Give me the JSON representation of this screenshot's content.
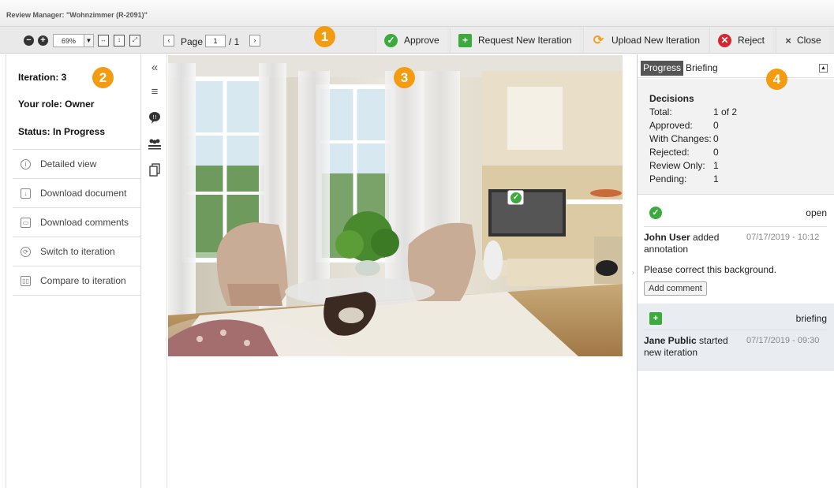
{
  "window": {
    "title": "Review Manager: \"Wohnzimmer (R-2091)\""
  },
  "toolbar": {
    "zoom_value": "69%",
    "page_label": "Page",
    "page_current": "1",
    "page_total": "/ 1",
    "approve": "Approve",
    "request_iteration": "Request New Iteration",
    "upload_iteration": "Upload New Iteration",
    "reject": "Reject",
    "close": "Close"
  },
  "badges": {
    "b1": "1",
    "b2": "2",
    "b3": "3",
    "b4": "4"
  },
  "info": {
    "iteration": "Iteration: 3",
    "role": "Your role: Owner",
    "status": "Status: In Progress"
  },
  "actions": [
    {
      "label": "Detailed view",
      "icon": "info-icon"
    },
    {
      "label": "Download document",
      "icon": "download-icon"
    },
    {
      "label": "Download comments",
      "icon": "comment-download-icon"
    },
    {
      "label": "Switch to iteration",
      "icon": "switch-icon"
    },
    {
      "label": "Compare to iteration",
      "icon": "compare-icon"
    }
  ],
  "tools": [
    "collapse-icon",
    "list-icon",
    "comment-icon",
    "users-icon",
    "pages-icon"
  ],
  "tabs": {
    "progress": "Progress",
    "briefing": "Briefing"
  },
  "decisions": {
    "title": "Decisions",
    "rows": [
      {
        "label": "Total:",
        "value": "1 of 2"
      },
      {
        "label": "Approved:",
        "value": "0"
      },
      {
        "label": "With Changes:",
        "value": "0"
      },
      {
        "label": "Rejected:",
        "value": "0"
      },
      {
        "label": "Review Only:",
        "value": "1"
      },
      {
        "label": "Pending:",
        "value": "1"
      }
    ]
  },
  "events": [
    {
      "type": "open",
      "user": "John User",
      "action": "added annotation",
      "date": "07/17/2019 - 10:12",
      "text": "Please correct this background.",
      "button": "Add comment"
    },
    {
      "type": "briefing",
      "user": "Jane Public",
      "action": "started new iteration",
      "date": "07/17/2019 - 09:30"
    }
  ],
  "colors": {
    "accent": "#f39c12",
    "approve": "#3caa3c",
    "reject": "#d9262c"
  }
}
